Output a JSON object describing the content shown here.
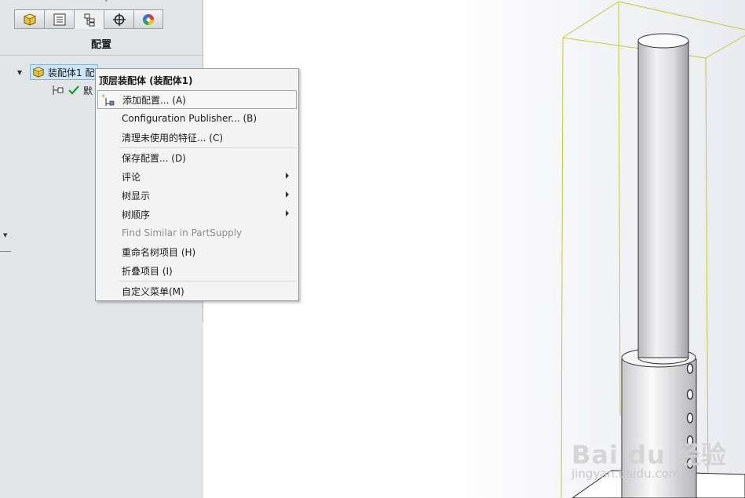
{
  "feature_manager": {
    "tabs": [
      {
        "name": "feature-tree",
        "icon": "assembly-cube-icon"
      },
      {
        "name": "property-manager",
        "icon": "property-list-icon"
      },
      {
        "name": "configuration-manager",
        "icon": "configuration-icon",
        "active": true
      },
      {
        "name": "dimxpert-manager",
        "icon": "crosshair-icon"
      },
      {
        "name": "display-manager",
        "icon": "color-wheel-icon"
      }
    ],
    "title": "配置",
    "root": {
      "label": "装配体1 配"
    },
    "child": {
      "label": "默"
    }
  },
  "context_menu": {
    "header": "顶层装配体 (装配体1)",
    "items": [
      {
        "label": "添加配置... (A)",
        "icon": "add-config-icon",
        "hover": true
      },
      {
        "label": "Configuration Publisher... (B)"
      },
      {
        "label": "清理未使用的特征... (C)"
      },
      {
        "label": "保存配置... (D)"
      },
      {
        "label": "评论",
        "submenu": true
      },
      {
        "label": "树显示",
        "submenu": true
      },
      {
        "label": "树顺序",
        "submenu": true
      },
      {
        "label": "Find Similar in PartSupply",
        "disabled": true
      },
      {
        "label": "重命名树项目 (H)"
      },
      {
        "label": "折叠项目 (I)"
      },
      {
        "label": "自定义菜单(M)"
      }
    ]
  },
  "colors": {
    "bounding_box": "#c8c832",
    "panel_bg": "#e2e5e8",
    "selection": "#cde6f7"
  },
  "watermark": {
    "main": "Bai du 经验",
    "sub": "jingyan.baidu.com"
  }
}
